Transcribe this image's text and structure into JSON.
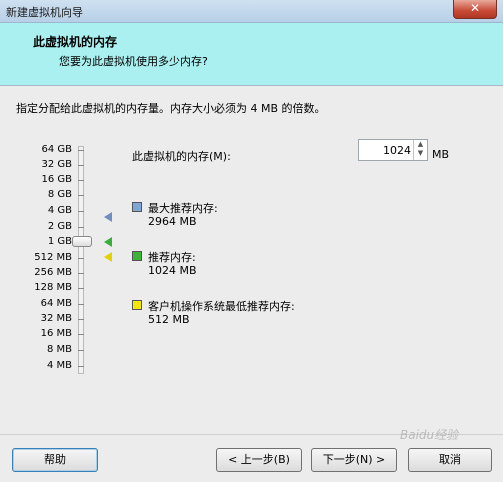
{
  "window": {
    "title": "新建虚拟机向导",
    "close_label": "✕"
  },
  "header": {
    "title": "此虚拟机的内存",
    "subtitle": "您要为此虚拟机使用多少内存?"
  },
  "instruction": "指定分配给此虚拟机的内存量。内存大小必须为 4 MB 的倍数。",
  "scale": {
    "labels": [
      "64 GB",
      "32 GB",
      "16 GB",
      "8 GB",
      "4 GB",
      "2 GB",
      "1 GB",
      "512 MB",
      "256 MB",
      "128 MB",
      "64 MB",
      "32 MB",
      "16 MB",
      "8 MB",
      "4 MB"
    ],
    "selected": "1 GB"
  },
  "memory": {
    "label": "此虚拟机的内存(M):",
    "value": "1024",
    "unit": "MB"
  },
  "legend": [
    {
      "title": "最大推荐内存:",
      "value": "2964 MB",
      "color": "#7fa6d6"
    },
    {
      "title": "推荐内存:",
      "value": "1024 MB",
      "color": "#3cb43c"
    },
    {
      "title": "客户机操作系统最低推荐内存:",
      "value": "512 MB",
      "color": "#f5e800"
    }
  ],
  "buttons": {
    "help": "帮助",
    "back": "< 上一步(B)",
    "next": "下一步(N) >",
    "cancel": "取消"
  },
  "watermark": "Baidu经验"
}
